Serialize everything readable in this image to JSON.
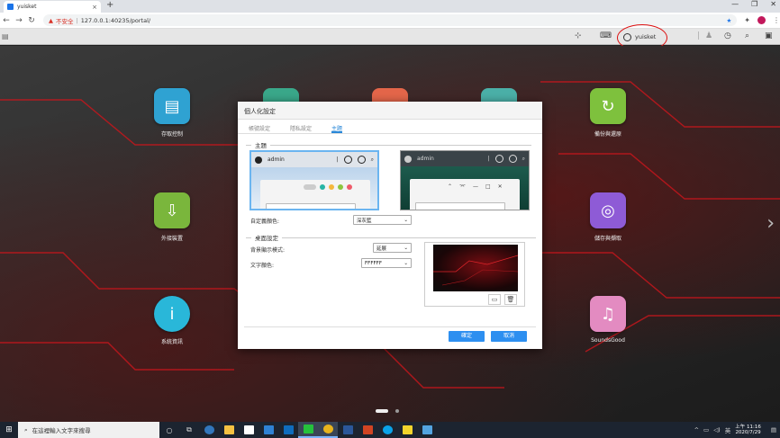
{
  "browser": {
    "tab_title": "yuisket",
    "tab_close": "×",
    "new_tab": "+",
    "window_controls": [
      "—",
      "❐",
      "✕"
    ],
    "security_label": "不安全",
    "url": "127.0.0.1:40235/portal/",
    "nav": {
      "back": "←",
      "forward": "→",
      "reload": "↻"
    },
    "profile_color": "#c2185b"
  },
  "nas_bar": {
    "menu_icon": "menu-icon",
    "user_label": "yuisket",
    "icons": [
      "notification-icon",
      "clock-icon",
      "search-icon",
      "dashboard-icon"
    ]
  },
  "desktop": {
    "apps": [
      {
        "label": "存取控制",
        "icon": "access-control-icon",
        "color": "#2fa2d2"
      },
      {
        "label": "外接裝置",
        "icon": "usb-drive-icon",
        "color": "#7ab63c"
      },
      {
        "label": "系統資訊",
        "icon": "info-icon",
        "color": "#29b7d9"
      },
      {
        "label": "備份與還原",
        "icon": "backup-icon",
        "color": "#7ec13d"
      },
      {
        "label": "儲存與擷取",
        "icon": "storage-icon",
        "color": "#8e5bd6"
      },
      {
        "label": "SoundsGood",
        "icon": "music-icon",
        "color": "#e38bc1"
      }
    ],
    "next_arrow": "›"
  },
  "dialog": {
    "title": "個人化設定",
    "tabs": [
      "帳號設定",
      "隱私設定",
      "主題"
    ],
    "active_tab": 2,
    "theme_section": "主題",
    "preview_user": "admin",
    "theme_color_label": "自定義顏色:",
    "theme_color_value": "深灰藍",
    "desktop_section": "桌面設定",
    "bg_mode_label": "背景顯示模式:",
    "bg_mode_value": "延展",
    "text_color_label": "文字顏色:",
    "text_color_value": "FFFFFF",
    "ok_label": "確定",
    "cancel_label": "取消",
    "accent_color": "#2d8ff0"
  },
  "taskbar": {
    "search_placeholder": "在這裡輸入文字來搜尋",
    "time": "上午 11:16",
    "date": "2020/7/29",
    "ime": "英",
    "tray_arrow": "^",
    "apps": [
      {
        "icon": "cortana-icon",
        "color": "#dddddd"
      },
      {
        "icon": "task-view-icon",
        "color": "#dddddd"
      },
      {
        "icon": "edge-icon",
        "color": "#3277bc"
      },
      {
        "icon": "file-explorer-icon",
        "color": "#f5c242"
      },
      {
        "icon": "store-icon",
        "color": "#ffffff"
      },
      {
        "icon": "mail-icon",
        "color": "#2f82d4"
      },
      {
        "icon": "outlook-icon",
        "color": "#0f6cbd"
      },
      {
        "icon": "line-icon",
        "color": "#25c13c"
      },
      {
        "icon": "chrome-icon",
        "color": "#e8b31d"
      },
      {
        "icon": "word-icon",
        "color": "#2b5799"
      },
      {
        "icon": "powerpoint-icon",
        "color": "#d04423"
      },
      {
        "icon": "skype-icon",
        "color": "#0aa2e8"
      },
      {
        "icon": "sticky-notes-icon",
        "color": "#f2d42c"
      },
      {
        "icon": "photos-icon",
        "color": "#53a4e0"
      }
    ]
  }
}
